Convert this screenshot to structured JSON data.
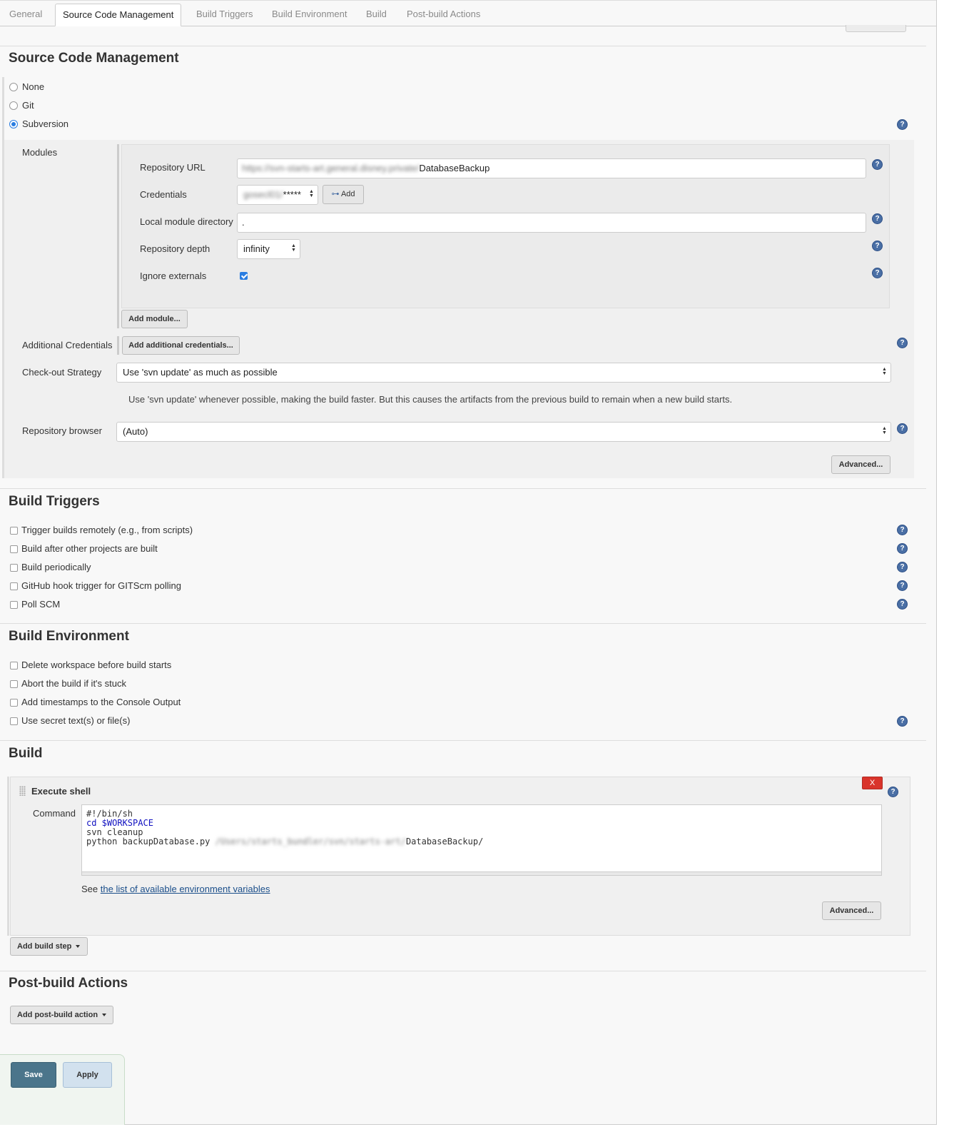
{
  "tabs": [
    "General",
    "Source Code Management",
    "Build Triggers",
    "Build Environment",
    "Build",
    "Post-build Actions"
  ],
  "scm": {
    "title": "Source Code Management",
    "options": [
      "None",
      "Git",
      "Subversion"
    ],
    "selected": "Subversion",
    "modules_label": "Modules",
    "repo_url_label": "Repository URL",
    "repo_url_value": "DatabaseBackup",
    "credentials_label": "Credentials",
    "credentials_mask": "*****",
    "add_label": "Add",
    "local_dir_label": "Local module directory",
    "local_dir_value": ".",
    "depth_label": "Repository depth",
    "depth_value": "infinity",
    "ignore_externals_label": "Ignore externals",
    "add_module": "Add module...",
    "additional_credentials_label": "Additional Credentials",
    "add_additional_credentials": "Add additional credentials...",
    "checkout_label": "Check-out Strategy",
    "checkout_value": "Use 'svn update' as much as possible",
    "checkout_desc": "Use 'svn update' whenever possible, making the build faster. But this causes the artifacts from the previous build to remain when a new build starts.",
    "browser_label": "Repository browser",
    "browser_value": "(Auto)",
    "advanced": "Advanced..."
  },
  "triggers": {
    "title": "Build Triggers",
    "items": [
      "Trigger builds remotely (e.g., from scripts)",
      "Build after other projects are built",
      "Build periodically",
      "GitHub hook trigger for GITScm polling",
      "Poll SCM"
    ]
  },
  "environment": {
    "title": "Build Environment",
    "items": [
      "Delete workspace before build starts",
      "Abort the build if it's stuck",
      "Add timestamps to the Console Output",
      "Use secret text(s) or file(s)"
    ]
  },
  "build": {
    "title": "Build",
    "step_title": "Execute shell",
    "delete": "X",
    "command_label": "Command",
    "code": [
      "#!/bin/sh",
      "cd $WORKSPACE",
      "svn cleanup",
      "python backupDatabase.py ",
      "DatabaseBackup/"
    ],
    "see_prefix": "See",
    "see_link": "the list of available environment variables",
    "advanced": "Advanced...",
    "add_step": "Add build step"
  },
  "post": {
    "title": "Post-build Actions",
    "add_action": "Add post-build action"
  },
  "footer": {
    "save": "Save",
    "apply": "Apply"
  },
  "help_glyph": "?"
}
